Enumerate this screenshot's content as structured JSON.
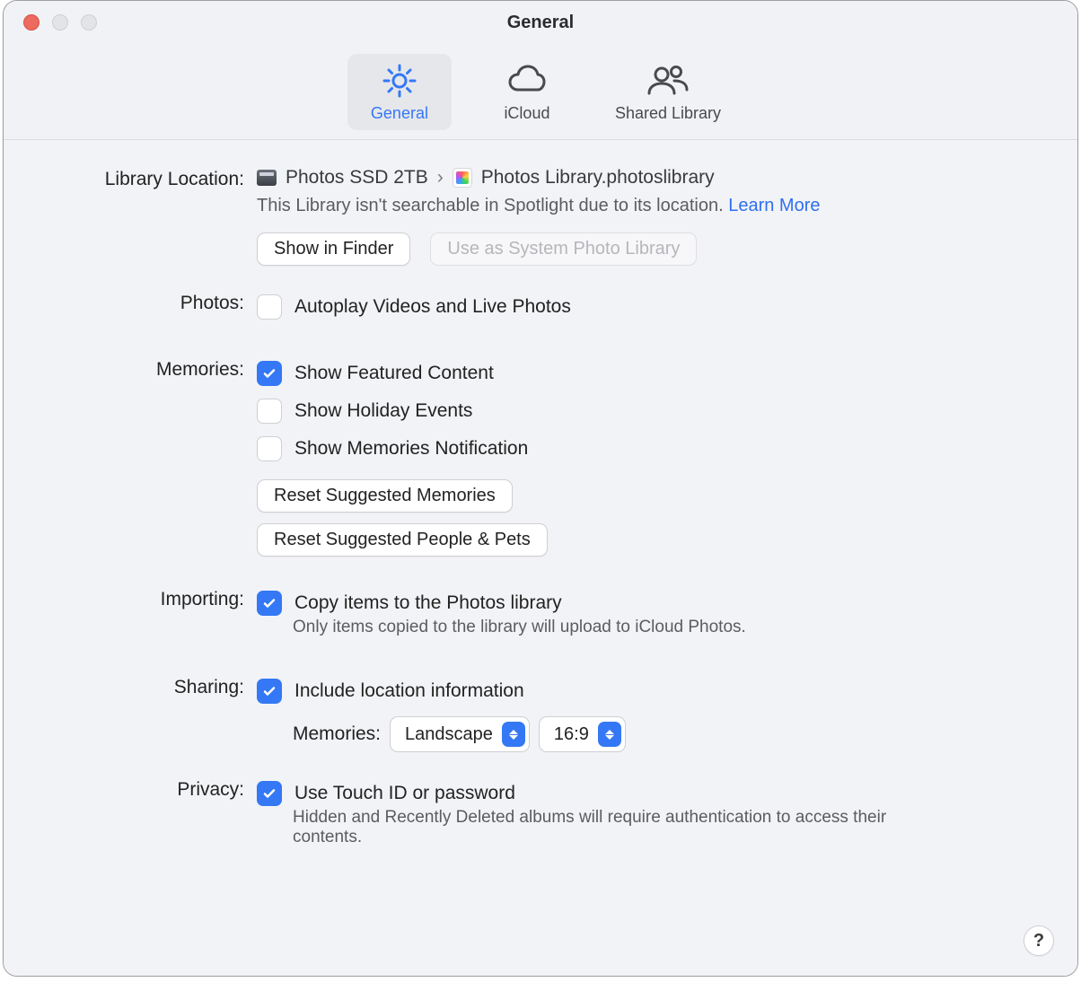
{
  "window": {
    "title": "General"
  },
  "tabs": {
    "general": "General",
    "icloud": "iCloud",
    "shared": "Shared Library"
  },
  "library": {
    "label": "Library Location:",
    "volume": "Photos SSD 2TB",
    "file": "Photos Library.photoslibrary",
    "note_prefix": "This Library isn't searchable in Spotlight due to its location. ",
    "learn_more": "Learn More",
    "show_in_finder": "Show in Finder",
    "use_as_system": "Use as System Photo Library"
  },
  "photos": {
    "label": "Photos:",
    "autoplay": "Autoplay Videos and Live Photos"
  },
  "memories": {
    "label": "Memories:",
    "featured": "Show Featured Content",
    "holiday": "Show Holiday Events",
    "notification": "Show Memories Notification",
    "reset_memories": "Reset Suggested Memories",
    "reset_people": "Reset Suggested People & Pets"
  },
  "importing": {
    "label": "Importing:",
    "copy": "Copy items to the Photos library",
    "note": "Only items copied to the library will upload to iCloud Photos."
  },
  "sharing": {
    "label": "Sharing:",
    "include_location": "Include location information",
    "memories_label": "Memories:",
    "orientation": "Landscape",
    "aspect": "16:9"
  },
  "privacy": {
    "label": "Privacy:",
    "touchid": "Use Touch ID or password",
    "note": "Hidden and Recently Deleted albums will require authentication to access their contents."
  },
  "help": "?"
}
